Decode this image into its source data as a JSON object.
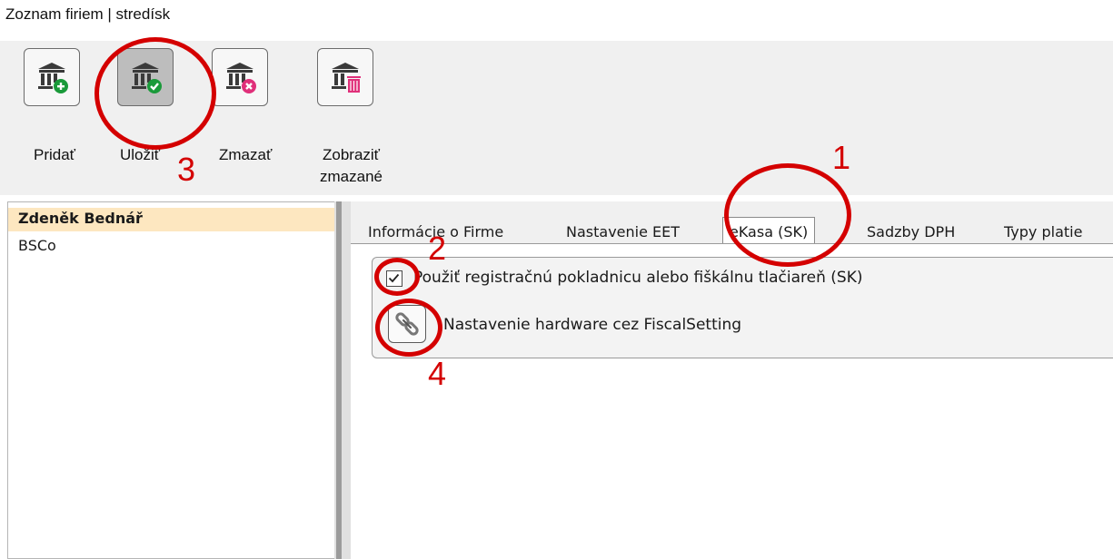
{
  "window": {
    "title": "Zoznam firiem | stredísk"
  },
  "toolbar": {
    "buttons": [
      {
        "label": "Pridať",
        "icon": "bank-add-icon"
      },
      {
        "label": "Uložiť",
        "icon": "bank-save-icon"
      },
      {
        "label": "Zmazať",
        "icon": "bank-delete-icon"
      },
      {
        "label_line1": "Zobraziť",
        "label_line2": "zmazané",
        "icon": "bank-trash-icon"
      }
    ]
  },
  "companies": {
    "items": [
      {
        "name": "Zdeněk Bednář",
        "selected": true
      },
      {
        "name": "BSCo",
        "selected": false
      }
    ]
  },
  "tabs": {
    "items": [
      {
        "label": "Informácie o Firme"
      },
      {
        "label": "Nastavenie EET"
      },
      {
        "label": "eKasa (SK)",
        "active": true
      },
      {
        "label": "Sadzby DPH"
      },
      {
        "label": "Typy platie"
      }
    ]
  },
  "ekasa": {
    "use_register_label": "Použiť registračnú pokladnicu alebo fiškálnu tlačiareň (SK)",
    "use_register_checked": true,
    "hardware_label": "Nastavenie hardware cez FiscalSetting"
  },
  "annotations": {
    "n1": "1",
    "n2": "2",
    "n3": "3",
    "n4": "4",
    "color": "#d40000"
  },
  "colors": {
    "selected_row": "#fde7c0",
    "add_badge": "#1a9a3a",
    "save_badge": "#1a9a3a",
    "delete_badge": "#e0307a",
    "trash_badge": "#e0307a"
  }
}
